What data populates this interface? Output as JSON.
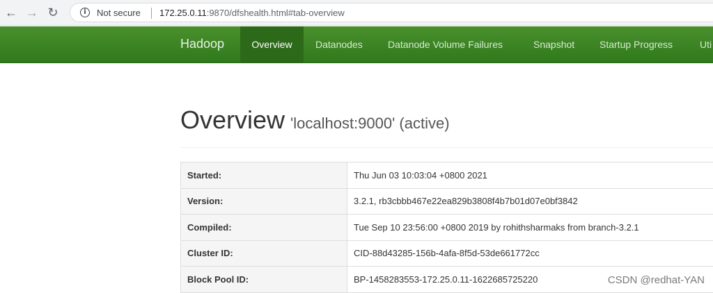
{
  "browser": {
    "security_label": "Not secure",
    "url_host": "172.25.0.11",
    "url_rest": ":9870/dfshealth.html#tab-overview"
  },
  "navbar": {
    "brand": "Hadoop",
    "items": [
      {
        "label": "Overview",
        "active": true
      },
      {
        "label": "Datanodes"
      },
      {
        "label": "Datanode Volume Failures"
      },
      {
        "label": "Snapshot"
      },
      {
        "label": "Startup Progress"
      },
      {
        "label": "Uti"
      }
    ]
  },
  "page": {
    "title": "Overview",
    "subtitle": "'localhost:9000' (active)"
  },
  "overview": {
    "rows": [
      {
        "key": "Started:",
        "value": "Thu Jun 03 10:03:04 +0800 2021"
      },
      {
        "key": "Version:",
        "value": "3.2.1, rb3cbbb467e22ea829b3808f4b7b01d07e0bf3842"
      },
      {
        "key": "Compiled:",
        "value": "Tue Sep 10 23:56:00 +0800 2019 by rohithsharmaks from branch-3.2.1"
      },
      {
        "key": "Cluster ID:",
        "value": "CID-88d43285-156b-4afa-8f5d-53de661772cc"
      },
      {
        "key": "Block Pool ID:",
        "value": "BP-1458283553-172.25.0.11-1622685725220"
      }
    ]
  },
  "watermark": "CSDN @redhat-YAN",
  "colors": {
    "navbar_green": "#3a8424",
    "navbar_active": "#2c6a19"
  }
}
